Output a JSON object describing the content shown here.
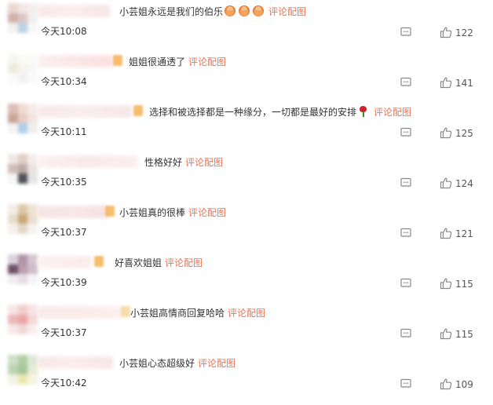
{
  "colors": {
    "link": "#eb7350",
    "text": "#333333",
    "icon": "#888888"
  },
  "link_label": "评论配图",
  "icons": {
    "reply": "comment-bubble-icon",
    "like": "thumbs-up-icon"
  },
  "comments": [
    {
      "text": "小芸姐永远是我们的伯乐",
      "time": "今天10:08",
      "likes": "122",
      "emoji": "raised-hands-emoji x3"
    },
    {
      "text": "姐姐很通透了",
      "time": "今天10:34",
      "likes": "141"
    },
    {
      "text": "选择和被选择都是一种缘分，一切都是最好的安排",
      "time": "今天10:11",
      "likes": "125",
      "emoji": "rose-emoji"
    },
    {
      "text": "性格好好",
      "time": "今天10:35",
      "likes": "124"
    },
    {
      "text": "小芸姐真的很棒",
      "time": "今天10:37",
      "likes": "121"
    },
    {
      "text": "好喜欢姐姐",
      "time": "今天10:39",
      "likes": "115"
    },
    {
      "text": "小芸姐高情商回复哈哈",
      "time": "今天10:37",
      "likes": "115"
    },
    {
      "text": "小芸姐心态超级好",
      "time": "今天10:42",
      "likes": "109"
    }
  ]
}
